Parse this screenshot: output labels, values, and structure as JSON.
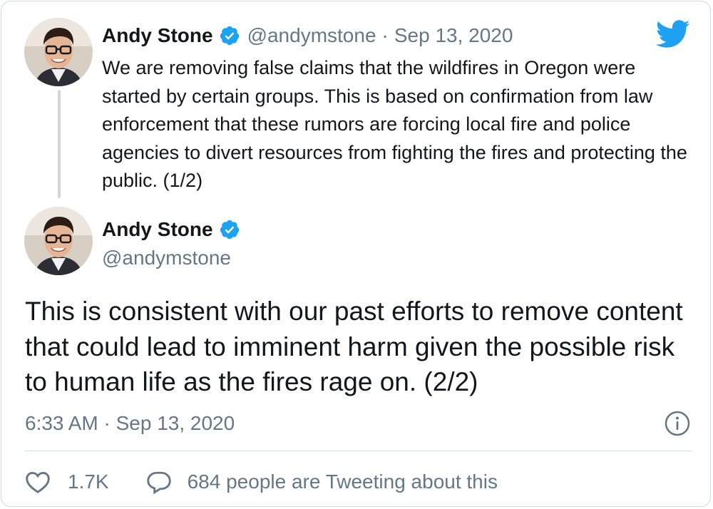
{
  "parent_tweet": {
    "author_name": "Andy Stone",
    "handle": "@andymstone",
    "separator": "·",
    "date": "Sep 13, 2020",
    "text": "We are removing false claims that the wildfires in Oregon were started by certain groups. This is based on confirmation from law enforcement that these rumors are forcing local fire and police agencies to divert resources from fighting the fires and protecting the public. (1/2)"
  },
  "main_tweet": {
    "author_name": "Andy Stone",
    "handle": "@andymstone",
    "text": "This is consistent with our past efforts to remove content that could lead to imminent harm given the possible risk to human life as the fires rage on. (2/2)",
    "timestamp": "6:33 AM · Sep 13, 2020"
  },
  "actions": {
    "like_count": "1.7K",
    "reply_label": "684 people are Tweeting about this"
  },
  "icons": {
    "brand": "twitter-bird-icon",
    "verified": "verified-badge-icon",
    "info": "info-icon",
    "like": "heart-icon",
    "reply": "speech-bubble-icon"
  },
  "colors": {
    "brand_blue": "#1da1f2",
    "text": "#14171a",
    "secondary_text": "#657786",
    "border": "#cfd9de"
  }
}
